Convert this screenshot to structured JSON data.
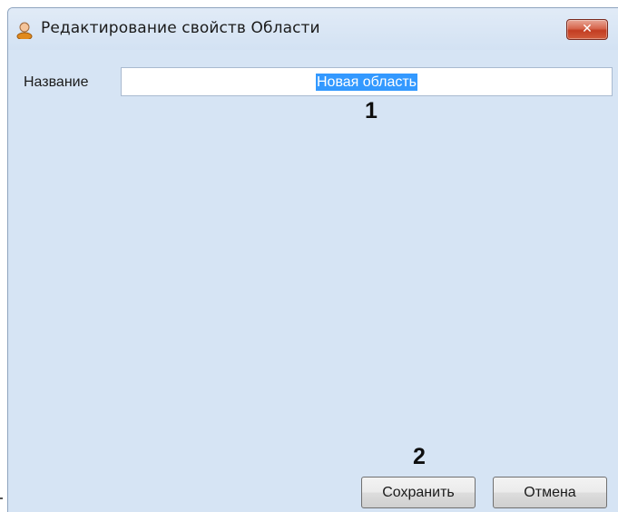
{
  "window": {
    "title": "Редактирование свойств Области",
    "icon": "user-icon",
    "close_glyph": "✕"
  },
  "form": {
    "name_label": "Название",
    "name_value": "Новая область"
  },
  "markers": {
    "one": "1",
    "two": "2"
  },
  "buttons": {
    "save_label": "Сохранить",
    "cancel_label": "Отмена"
  },
  "colors": {
    "selection": "#3399ff",
    "close_button": "#c23d22",
    "client_background": "#d6e4f4"
  }
}
